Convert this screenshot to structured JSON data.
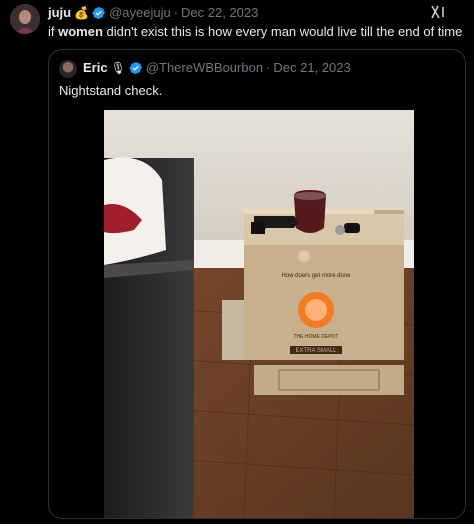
{
  "tweet": {
    "display_name": "juju",
    "name_emoji": "💰",
    "handle": "@ayeejuju",
    "separator": "·",
    "date": "Dec 22, 2023",
    "text_before": "if ",
    "text_bold": "women",
    "text_after": " didn't exist this is how every man would live till the end of time",
    "grok_label": "✗|"
  },
  "quote": {
    "display_name": "Eric",
    "name_emoji": "🎙",
    "handle": "@ThereWBBourbon",
    "separator": "·",
    "date": "Dec 21, 2023",
    "text": "Nightstand check.",
    "box_text": "How doers get more done",
    "box_label": "EXTRA SMALL",
    "box_brand": "THE HOME DEPOT"
  },
  "colors": {
    "background": "#000000",
    "text_primary": "#e7e9ea",
    "text_secondary": "#71767b",
    "verified": "#1d9bf0",
    "border": "#2f3336"
  },
  "icons": [
    "avatar",
    "verified-badge-icon",
    "grok-icon"
  ]
}
